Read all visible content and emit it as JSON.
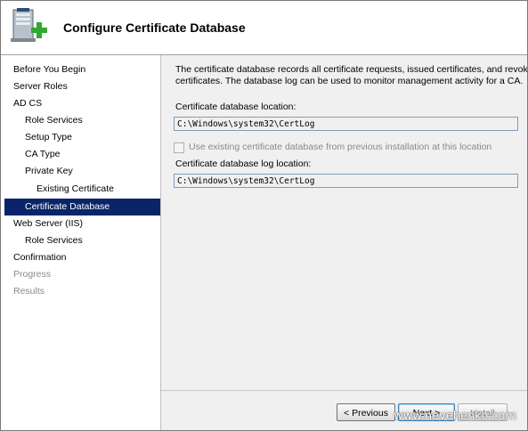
{
  "header": {
    "title": "Configure Certificate Database",
    "icon": "server-add-icon"
  },
  "nav": {
    "items": [
      {
        "label": "Before You Begin",
        "level": 0,
        "state": "normal"
      },
      {
        "label": "Server Roles",
        "level": 0,
        "state": "normal"
      },
      {
        "label": "AD CS",
        "level": 0,
        "state": "normal"
      },
      {
        "label": "Role Services",
        "level": 1,
        "state": "normal"
      },
      {
        "label": "Setup Type",
        "level": 1,
        "state": "normal"
      },
      {
        "label": "CA Type",
        "level": 1,
        "state": "normal"
      },
      {
        "label": "Private Key",
        "level": 1,
        "state": "normal"
      },
      {
        "label": "Existing Certificate",
        "level": 2,
        "state": "normal"
      },
      {
        "label": "Certificate Database",
        "level": 1,
        "state": "selected"
      },
      {
        "label": "Web Server (IIS)",
        "level": 0,
        "state": "normal"
      },
      {
        "label": "Role Services",
        "level": 1,
        "state": "normal"
      },
      {
        "label": "Confirmation",
        "level": 0,
        "state": "normal"
      },
      {
        "label": "Progress",
        "level": 0,
        "state": "disabled"
      },
      {
        "label": "Results",
        "level": 0,
        "state": "disabled"
      }
    ]
  },
  "content": {
    "description_line1": "The certificate database records all certificate requests, issued certificates, and revoked or ex",
    "description_line2": "certificates. The database log can be used to monitor management activity for a CA.",
    "db_location_label": "Certificate database location:",
    "db_location_value": "C:\\Windows\\system32\\CertLog",
    "use_existing_label": "Use existing certificate database from previous installation at this location",
    "use_existing_checked": false,
    "log_location_label": "Certificate database log location:",
    "log_location_value": "C:\\Windows\\system32\\CertLog"
  },
  "footer": {
    "previous_label": "< Previous",
    "next_label": "Next >",
    "install_label": "Install"
  },
  "watermark": "www.nevehenko.com"
}
